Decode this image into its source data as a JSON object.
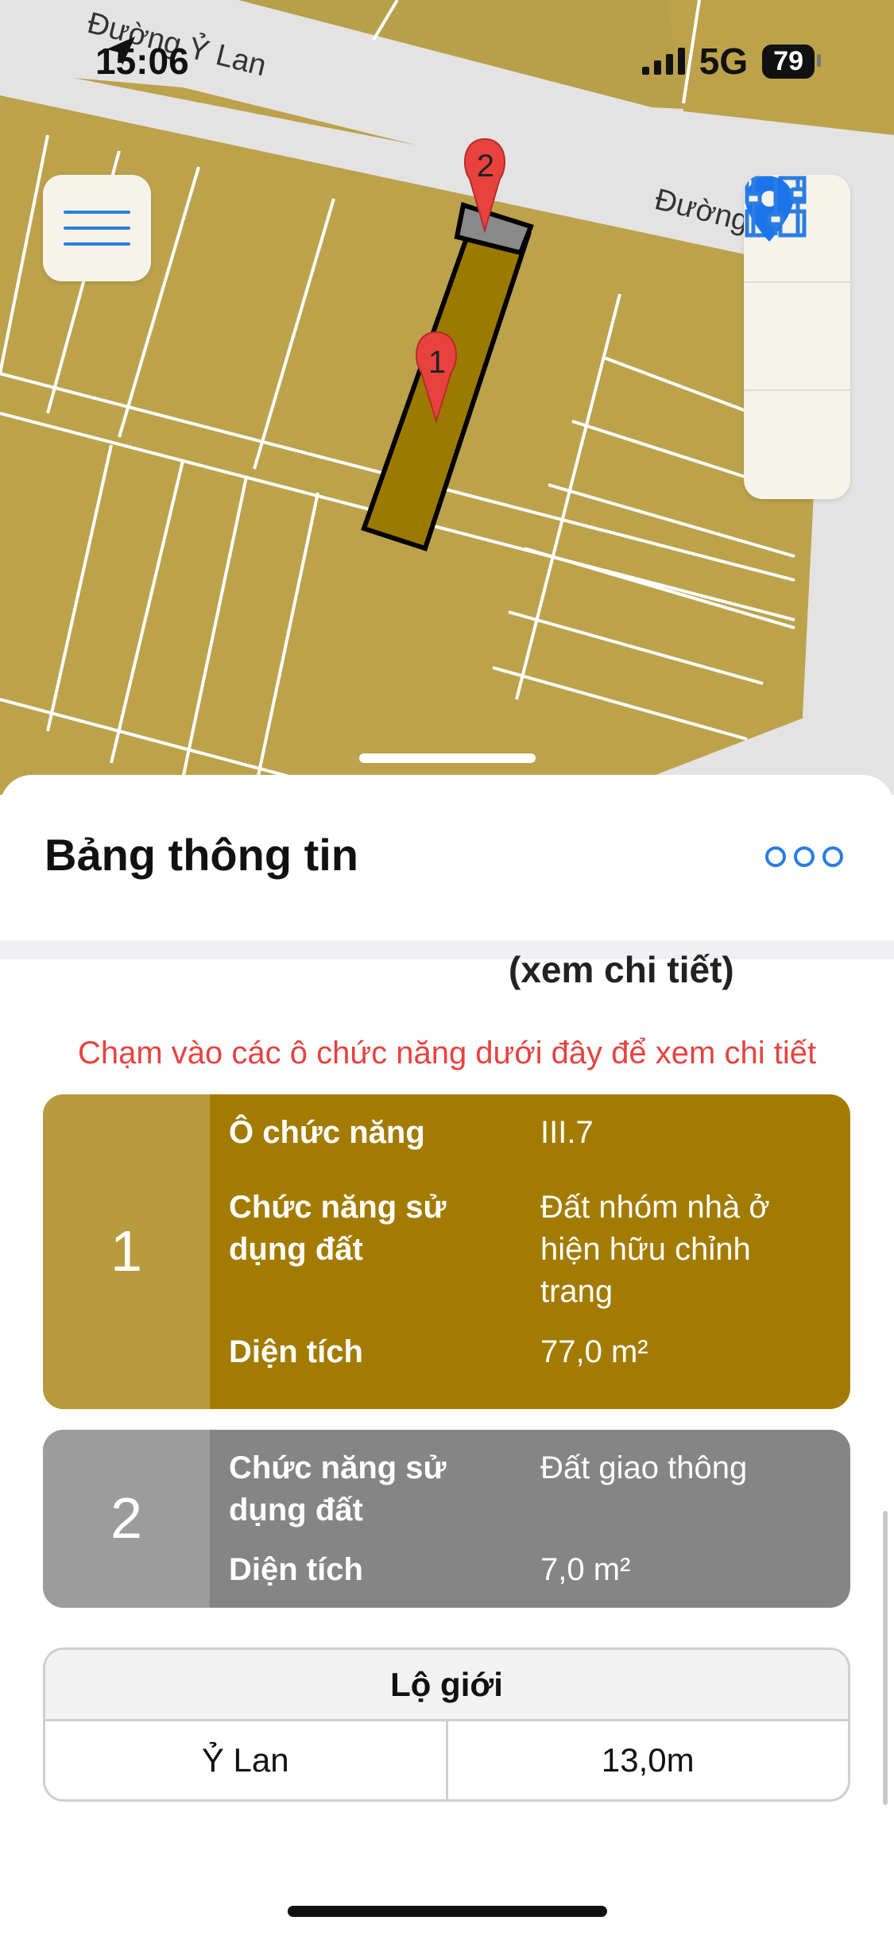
{
  "status_bar": {
    "time": "15:06",
    "network": "5G",
    "battery": "79"
  },
  "map": {
    "street_labels": [
      "Đường Ỷ Lan",
      "Đường"
    ],
    "markers": [
      "1",
      "2"
    ],
    "colors": {
      "land": "#bda24c",
      "selected_parcel": "#9c7a00",
      "road": "#e3e3e3",
      "marker": "#e8423f",
      "accent": "#2a7de1"
    },
    "controls": [
      "menu-icon",
      "grid-icon",
      "location-pin-icon",
      "sliders-icon"
    ]
  },
  "sheet": {
    "title": "Bảng thông tin",
    "cut_link": "(xem chi tiết)",
    "hint": "Chạm vào các ô chức năng dưới đây để xem chi tiết",
    "cards": [
      {
        "number": "1",
        "rows": [
          {
            "label": "Ô chức năng",
            "value": "III.7"
          },
          {
            "label": "Chức năng sử dụng đất",
            "value": "Đất nhóm nhà ở hiện hữu chỉnh trang"
          },
          {
            "label": "Diện tích",
            "value": "77,0 m²"
          }
        ]
      },
      {
        "number": "2",
        "rows": [
          {
            "label": "Chức năng sử dụng đất",
            "value": "Đất giao thông"
          },
          {
            "label": "Diện tích",
            "value": "7,0 m²"
          }
        ]
      }
    ],
    "road_table": {
      "header": "Lộ giới",
      "rows": [
        {
          "street": "Ỷ Lan",
          "width": "13,0m"
        }
      ]
    }
  }
}
